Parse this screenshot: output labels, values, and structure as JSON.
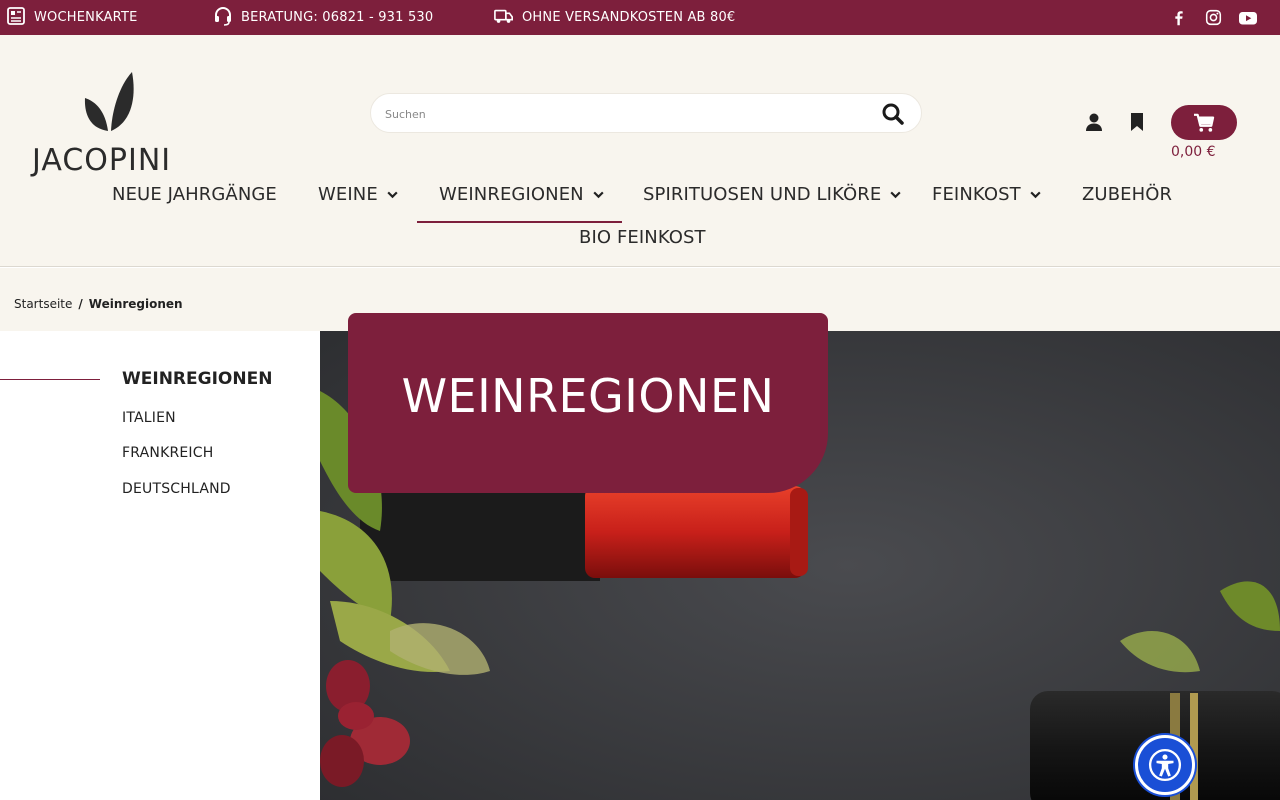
{
  "topbar": {
    "weekly": "WOCHENKARTE",
    "advice": "BERATUNG: 06821 - 931 530",
    "shipping": "OHNE VERSANDKOSTEN AB 80€"
  },
  "logo": {
    "text": "JACOPINI"
  },
  "search": {
    "placeholder": "Suchen"
  },
  "cart": {
    "total": "0,00 €"
  },
  "nav": {
    "items": [
      {
        "label": "NEUE JAHRGÄNGE"
      },
      {
        "label": "WEINE"
      },
      {
        "label": "WEINREGIONEN"
      },
      {
        "label": "SPIRITUOSEN UND LIKÖRE"
      },
      {
        "label": "FEINKOST"
      },
      {
        "label": "ZUBEHÖR"
      },
      {
        "label": "BIO FEINKOST"
      }
    ]
  },
  "breadcrumb": {
    "home": "Startseite",
    "sep": "/",
    "current": "Weinregionen"
  },
  "sidebar": {
    "title": "WEINREGIONEN",
    "links": [
      "ITALIEN",
      "FRANKREICH",
      "DEUTSCHLAND"
    ]
  },
  "hero": {
    "title": "WEINREGIONEN"
  },
  "colors": {
    "brand": "#7d1f3c",
    "header_bg": "#f8f5ee",
    "accessibility": "#1a4fd6"
  }
}
